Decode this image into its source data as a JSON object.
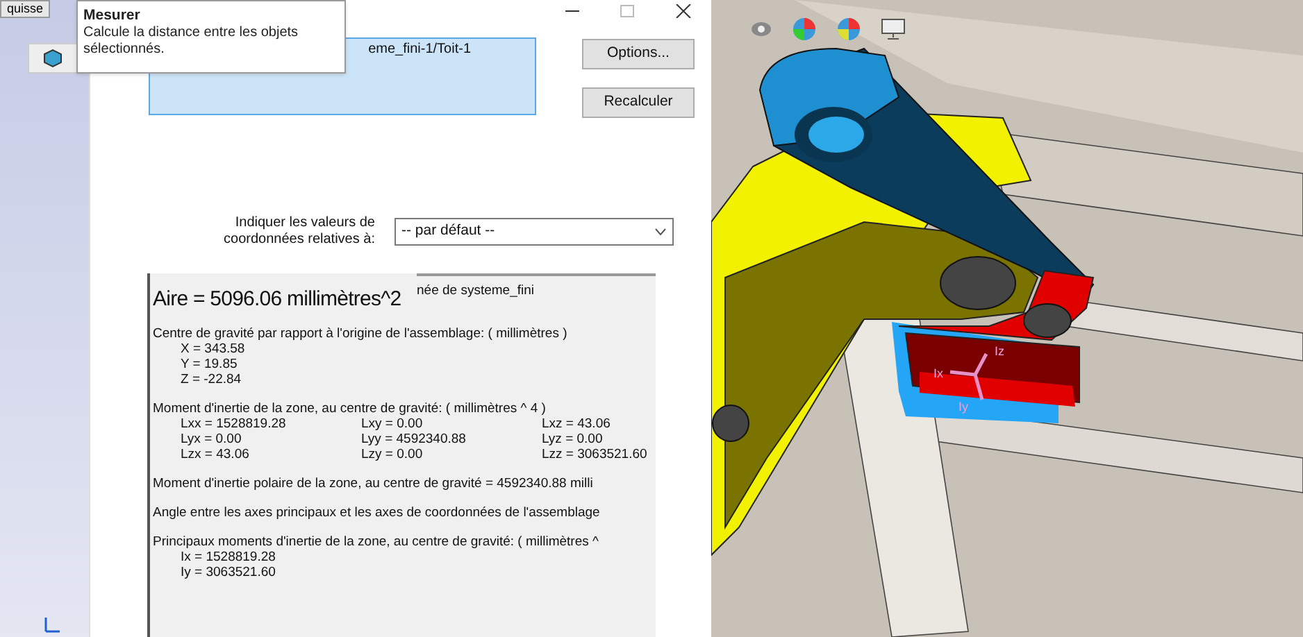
{
  "feature_tree": {
    "tab": "quisse"
  },
  "tooltip": {
    "title": "Mesurer",
    "text": "Calcule la distance entre les objets sélectionnés."
  },
  "dialog": {
    "selection_list": [
      "eme_fini-1/Toit-1"
    ],
    "buttons": [
      "Options...",
      "Recalculer"
    ],
    "coordinate_label": "Indiquer les valeurs de coordonnées relatives à:",
    "coordinate_select": {
      "value": "-- par défaut --"
    },
    "results": {
      "header": "née de systeme_fini",
      "area": "Aire = 5096.06 millimètres^2",
      "sections": [
        {
          "title": "Centre de gravité par rapport à l'origine de l'assemblage: ( millimètres )",
          "rows": [
            [
              "X = 343.58"
            ],
            [
              "Y = 19.85"
            ],
            [
              "Z = -22.84"
            ]
          ]
        },
        {
          "title": "Moment d'inertie de la zone, au centre de gravité: ( millimètres ^ 4 )",
          "rows": [
            [
              "Lxx = 1528819.28",
              "Lxy = 0.00",
              "Lxz = 43.06"
            ],
            [
              "Lyx = 0.00",
              "Lyy = 4592340.88",
              "Lyz = 0.00"
            ],
            [
              "Lzx = 43.06",
              "Lzy = 0.00",
              "Lzz = 3063521.60"
            ]
          ]
        },
        {
          "title": "Moment d'inertie polaire de la zone, au centre de gravité = 4592340.88 milli"
        },
        {
          "title": "Angle entre les axes principaux et les axes de coordonnées de l'assemblage"
        },
        {
          "title": "Principaux moments d'inertie de la zone, au centre de gravité: ( millimètres ^",
          "rows": [
            [
              "Ix = 1528819.28"
            ],
            [
              "Iy = 3063521.60"
            ]
          ]
        }
      ]
    }
  },
  "viewport": {
    "axis_labels": [
      "Iz",
      "Ix",
      "Iy"
    ]
  }
}
